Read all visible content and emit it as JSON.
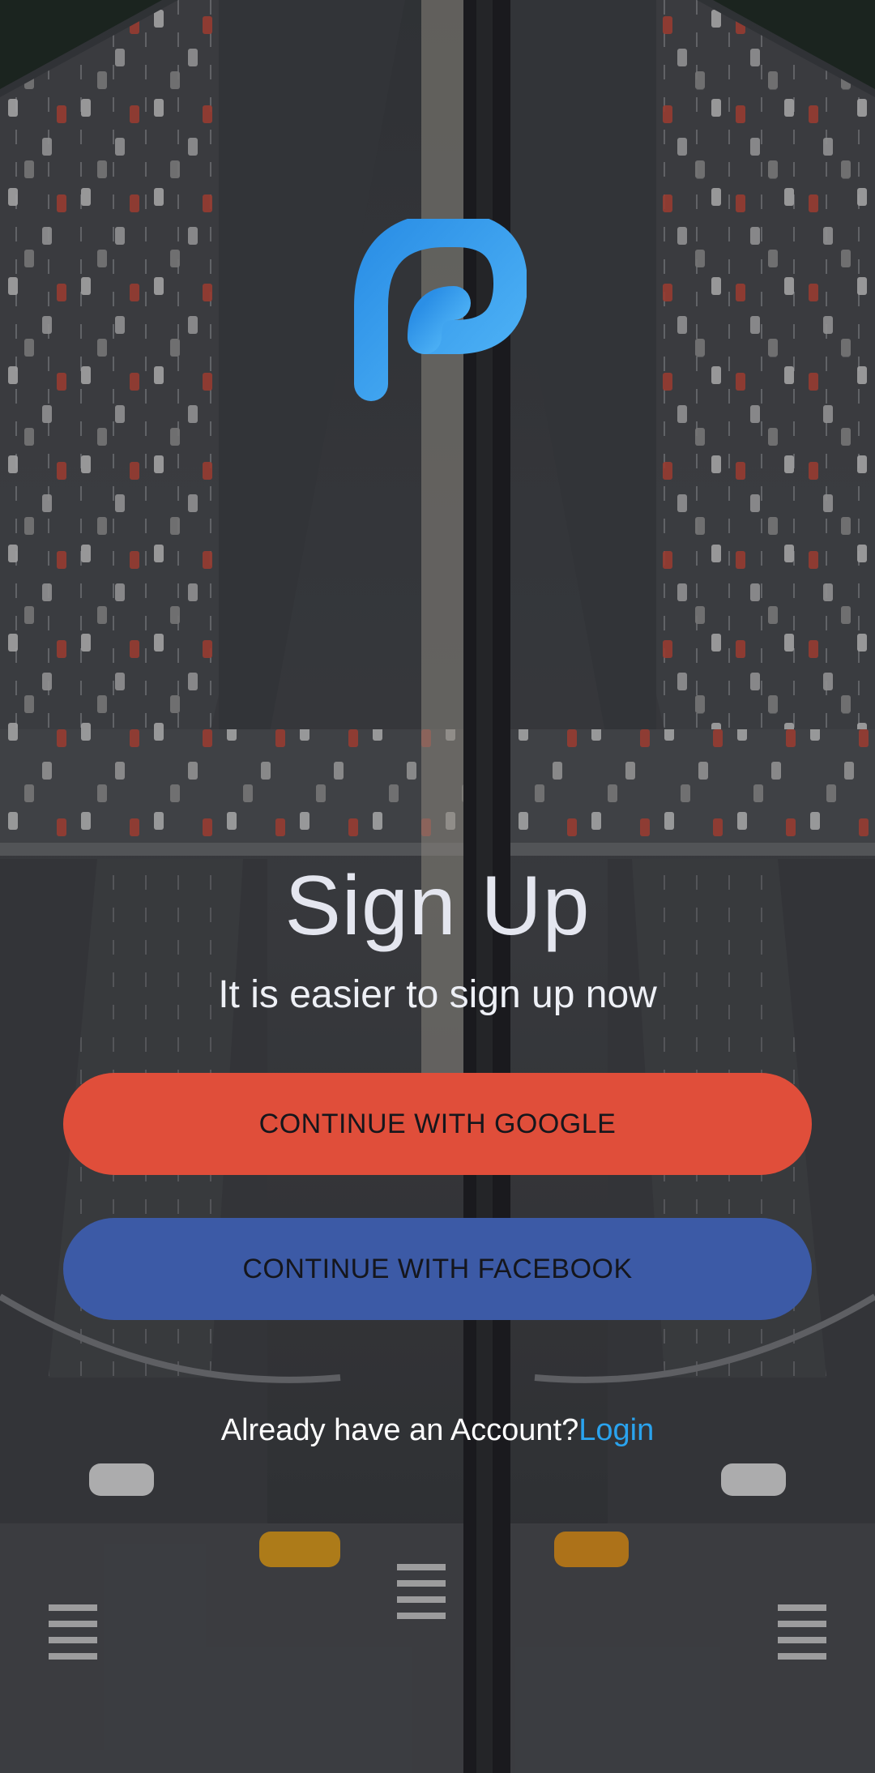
{
  "brand": {
    "logo_icon": "p-letter-logo-icon",
    "logo_color_light": "#4fb3f6",
    "logo_color_dark": "#2b8fe6"
  },
  "background": {
    "description_icon": "city-highway-aerial-photo"
  },
  "header": {
    "title": "Sign Up",
    "subtitle": "It is easier to sign up now"
  },
  "buttons": {
    "google_label": "CONTINUE WITH GOOGLE",
    "google_color": "#e04e3a",
    "facebook_label": "CONTINUE WITH FACEBOOK",
    "facebook_color": "#3c5aa6"
  },
  "footer": {
    "prompt": "Already have an Account?",
    "login_label": "Login",
    "login_color": "#2aa3ee"
  }
}
